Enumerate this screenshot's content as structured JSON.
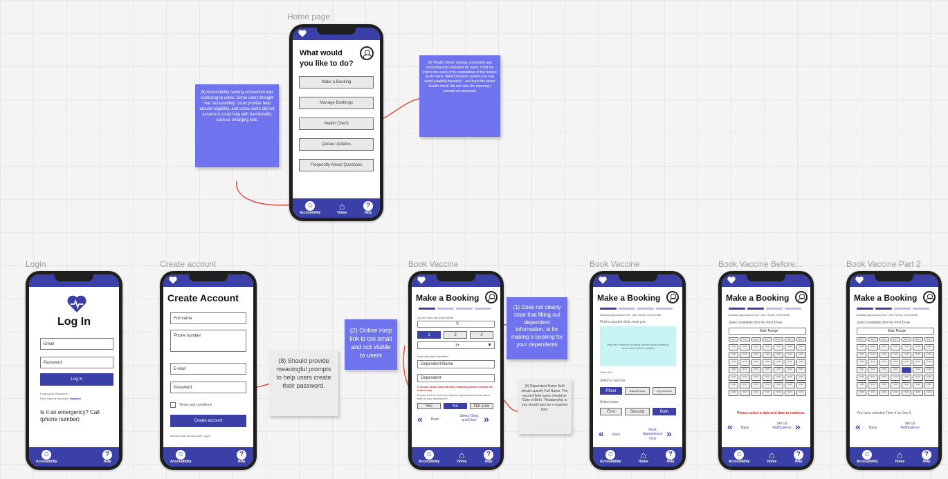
{
  "frames": {
    "home": "Home page",
    "login": "Login",
    "create": "Create account",
    "bv1": "Book Vaccine",
    "bv2": "Book Vaccine",
    "bv3": "Book Vaccine Before...",
    "bv4": "Book Vaccine Part 2"
  },
  "nav": {
    "accessibility": "Accessibility",
    "home": "Home",
    "help": "Help"
  },
  "home": {
    "title": "What would you like to do?",
    "buttons": [
      "Make a Booking",
      "Manage Bookings",
      "Health Check",
      "Queue Updates",
      "Frequently Asked Questions"
    ]
  },
  "notes": {
    "n5": "(5) Accessibility naming convention was confusing to users. Some users thought that 'Accessibility' could provide help around eligibility, and some users did not assume it could help with functionality such as enlarging text.",
    "n6": "(6) 'Health Check' naming convention was confusing and unintuitive for users. It did not inform the users of the capabilities of the feature by its name. Match between system and real world (usability heuristic) - we found the words 'health check' did not have the meaning / concept we assumed.",
    "n8": "(8) Should provide meaningful prompts to help users create their password.",
    "n2": "(2) Online Help link is too small and not visible to users",
    "n1": "(1) Does not clearly state that filling out dependent information, is for making a booking for your dependents",
    "n9": "(9) Dependent Name field should specify Full Name. The second field name should be 'Date of Birth'. Relationship to you should also be a required field."
  },
  "login": {
    "title": "Log In",
    "email": "Email",
    "password": "Password",
    "login_btn": "Log In",
    "forgot": "Forgot your Password?",
    "no_account": "Don't have an account?",
    "register": "Register",
    "emergency": "Is it an emergency? Call (phone number)"
  },
  "create": {
    "title": "Create Account",
    "fullname": "Full name",
    "phone": "Phone number",
    "email": "E-mail",
    "password": "Password",
    "terms": "Terms and conditions",
    "btn": "Create account",
    "already": "Already have an account? Log in"
  },
  "booking": {
    "title": "Make a Booking",
    "steps": [
      "Step 1",
      "Step 2",
      "Step 3",
      "Step 4"
    ],
    "dep_q": "Do you have any dependents",
    "dep_count": "0",
    "opts": [
      "1",
      "2",
      "3"
    ],
    "select": "1+",
    "dep_info": "Dependent(s) Information",
    "dep_name": "Dependent Name",
    "dep_field2": "Dependent",
    "warn": "If unsure about dependent(s) eligibility please contact the online help",
    "same_time": "Do you wish to book your vaccine appointment at the same time as your dependent?",
    "yes_no": [
      "Yes",
      "No",
      "Not sure"
    ],
    "back": "Back",
    "next1": "Select Clinic and Dose",
    "patient": "Booking Appointment for: John Smith, 01/01/1986",
    "find_clinic": "Find a vaccine clinic near you:",
    "map": "Map with markers showing vaccine clinic locations near users current location",
    "clinic_val": "Clinic 101",
    "select_vaccine": "Select a vaccine:",
    "vaccines": [
      "Pfizer",
      "AstraZeneca",
      "Any Vaccine"
    ],
    "select_dose": "Select dose:",
    "doses": [
      "First",
      "Second",
      "Both"
    ],
    "next2": "Book Appointment Time",
    "select_time": "Select available time for First Dose",
    "date_range": "Date Range",
    "days": [
      "Day 1",
      "Day 2",
      "Day 3",
      "Day 4",
      "Day 5",
      "Day 6",
      "Day 7"
    ],
    "time": "9:00",
    "please": "Please select a date and time to continue.",
    "next3": "Set Up Notifications",
    "selected": "You have selected Time 4 on Day 5."
  },
  "colors": {
    "primary": "#3b3fa8",
    "sticky": "#6f73ee",
    "arrow": "#e24b3b"
  }
}
